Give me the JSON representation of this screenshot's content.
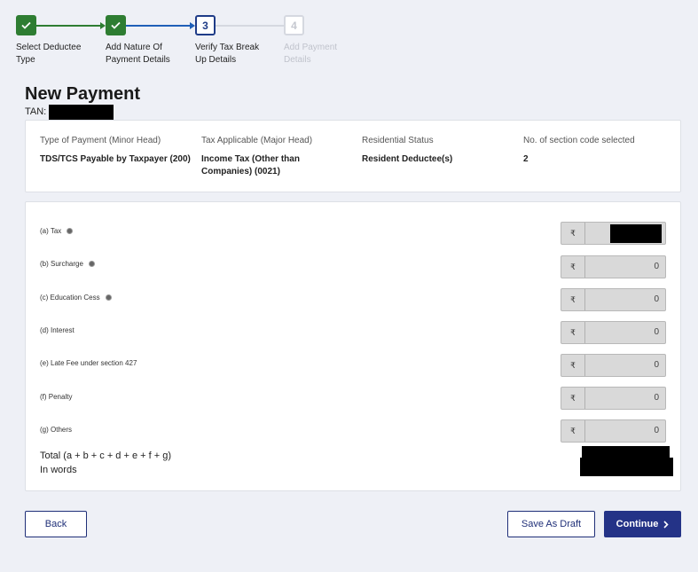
{
  "stepper": {
    "steps": [
      {
        "num": "",
        "label": "Select Deductee Type",
        "state": "done"
      },
      {
        "num": "",
        "label": "Add Nature Of Payment Details",
        "state": "done"
      },
      {
        "num": "3",
        "label": "Verify Tax Break Up Details",
        "state": "current"
      },
      {
        "num": "4",
        "label": "Add Payment Details",
        "state": "future"
      }
    ]
  },
  "page": {
    "title": "New Payment",
    "tan_label": "TAN:"
  },
  "summary": {
    "columns": [
      {
        "header": "Type of Payment (Minor Head)",
        "value": "TDS/TCS Payable by Taxpayer (200)"
      },
      {
        "header": "Tax Applicable (Major Head)",
        "value": "Income Tax (Other than Companies) (0021)"
      },
      {
        "header": "Residential Status",
        "value": "Resident Deductee(s)"
      },
      {
        "header": "No. of section code selected",
        "value": "2"
      }
    ]
  },
  "breakup": {
    "currency_symbol": "₹",
    "rows": [
      {
        "label": "(a) Tax",
        "info": true,
        "value": ""
      },
      {
        "label": "(b) Surcharge",
        "info": true,
        "value": "0"
      },
      {
        "label": "(c) Education Cess",
        "info": true,
        "value": "0"
      },
      {
        "label": "(d) Interest",
        "info": false,
        "value": "0"
      },
      {
        "label": "(e) Late Fee under section 427",
        "info": false,
        "value": "0"
      },
      {
        "label": "(f) Penalty",
        "info": false,
        "value": "0"
      },
      {
        "label": "(g) Others",
        "info": false,
        "value": "0"
      }
    ],
    "total_label": "Total (a + b + c + d + e + f + g)",
    "in_words_label": "In words"
  },
  "actions": {
    "back": "Back",
    "save_draft": "Save As Draft",
    "continue": "Continue",
    "continue_icon": "chevron-right-icon"
  },
  "colors": {
    "done": "#2e7d32",
    "current": "#1f3c88",
    "primary_button": "#243387"
  }
}
